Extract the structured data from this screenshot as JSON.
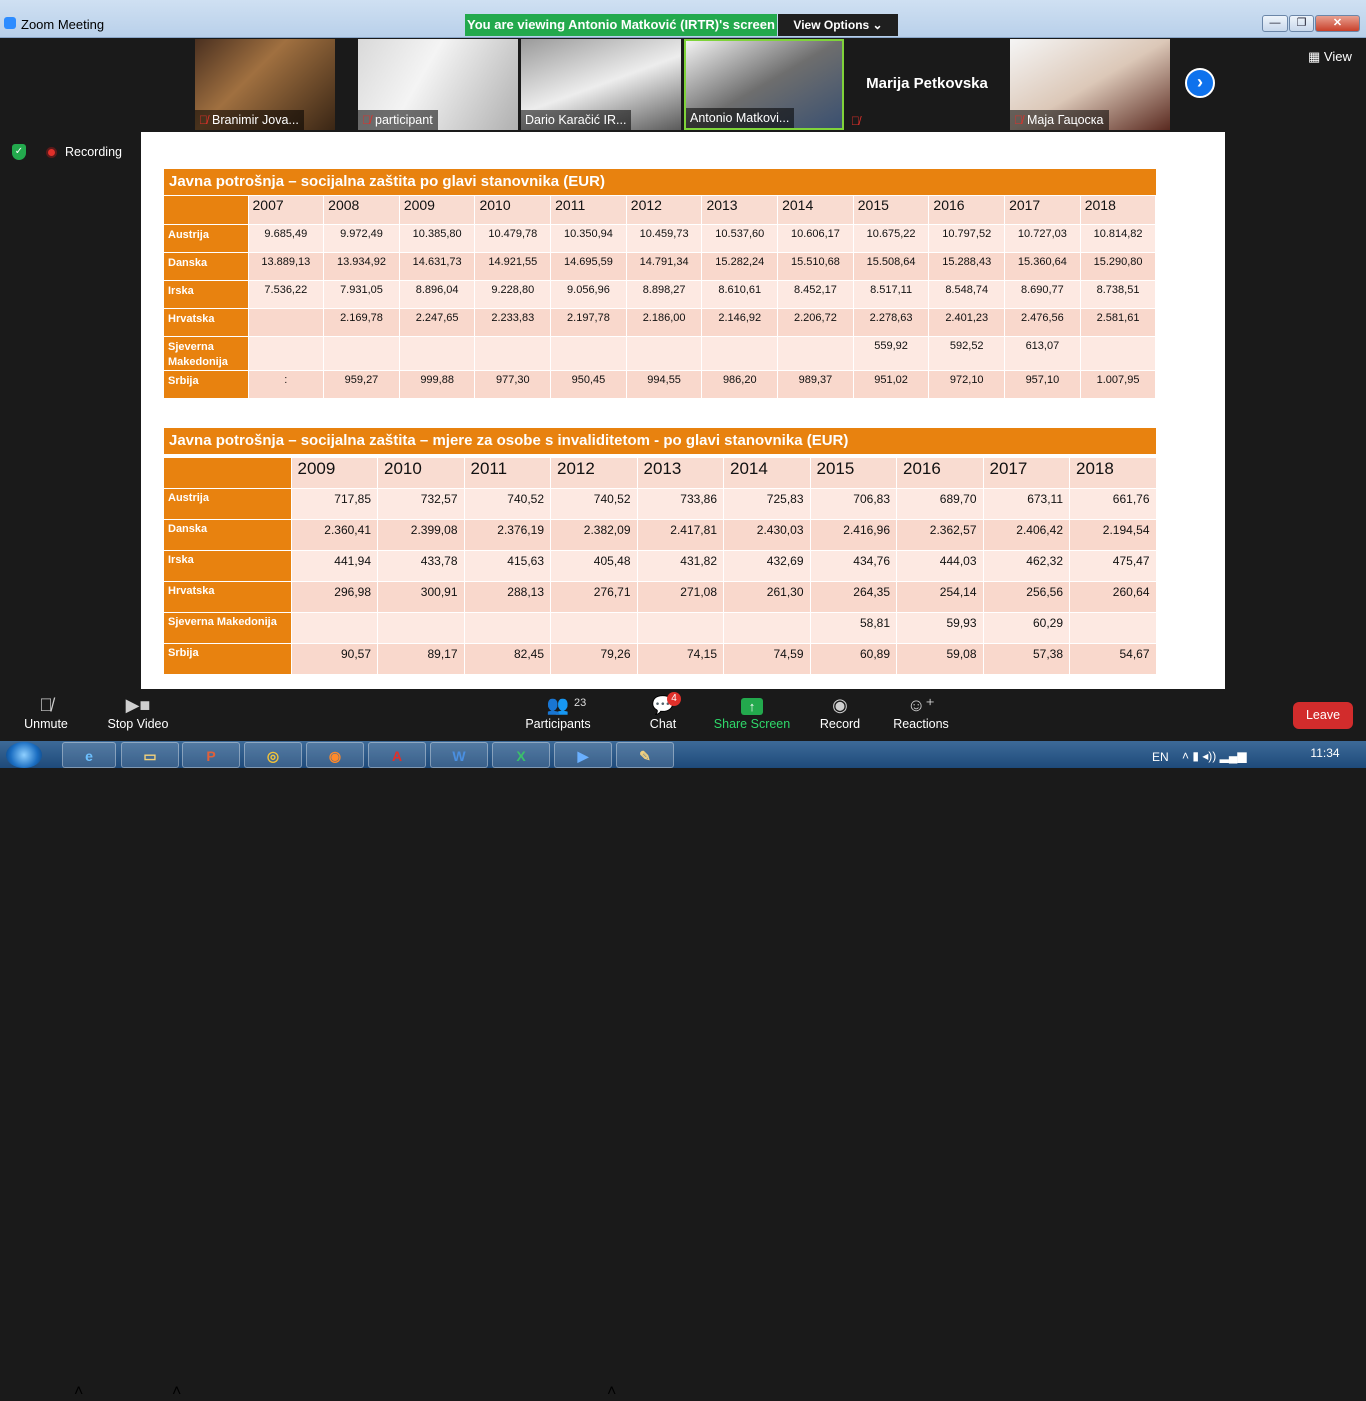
{
  "window": {
    "title": "Zoom Meeting",
    "viewing_banner": "You are viewing Antonio Matković (IRTR)'s screen",
    "view_options": "View Options ⌄",
    "minimize": "—",
    "maximize": "❐",
    "close": "✕"
  },
  "video_strip": {
    "participants": [
      {
        "name": "Branimir Jova...",
        "muted": true
      },
      {
        "name": "participant",
        "muted": true
      },
      {
        "name": "Dario Karačić IR...",
        "muted": false
      },
      {
        "name": "Antonio Matkovi...",
        "muted": false,
        "active_speaker": true
      },
      {
        "name": "Marija Petkovska",
        "muted": true,
        "video_off": true
      },
      {
        "name": "Maja Гацоска",
        "muted": true
      }
    ],
    "next_icon": "chevron-right-icon",
    "view_label": "View"
  },
  "status": {
    "recording_label": "Recording"
  },
  "slide": {
    "table1": {
      "title": "Javna potrošnja – socijalna zaštita po glavi stanovnika (EUR)",
      "years": [
        "2007",
        "2008",
        "2009",
        "2010",
        "2011",
        "2012",
        "2013",
        "2014",
        "2015",
        "2016",
        "2017",
        "2018"
      ],
      "rows": [
        {
          "country": "Austrija",
          "values": [
            "9.685,49",
            "9.972,49",
            "10.385,80",
            "10.479,78",
            "10.350,94",
            "10.459,73",
            "10.537,60",
            "10.606,17",
            "10.675,22",
            "10.797,52",
            "10.727,03",
            "10.814,82"
          ]
        },
        {
          "country": "Danska",
          "values": [
            "13.889,13",
            "13.934,92",
            "14.631,73",
            "14.921,55",
            "14.695,59",
            "14.791,34",
            "15.282,24",
            "15.510,68",
            "15.508,64",
            "15.288,43",
            "15.360,64",
            "15.290,80"
          ]
        },
        {
          "country": "Irska",
          "values": [
            "7.536,22",
            "7.931,05",
            "8.896,04",
            "9.228,80",
            "9.056,96",
            "8.898,27",
            "8.610,61",
            "8.452,17",
            "8.517,11",
            "8.548,74",
            "8.690,77",
            "8.738,51"
          ]
        },
        {
          "country": "Hrvatska",
          "values": [
            "",
            "2.169,78",
            "2.247,65",
            "2.233,83",
            "2.197,78",
            "2.186,00",
            "2.146,92",
            "2.206,72",
            "2.278,63",
            "2.401,23",
            "2.476,56",
            "2.581,61"
          ]
        },
        {
          "country": "Sjeverna Makedonija",
          "values": [
            "",
            "",
            "",
            "",
            "",
            "",
            "",
            "",
            "559,92",
            "592,52",
            "613,07",
            ""
          ]
        },
        {
          "country": "Srbija",
          "values": [
            ":",
            "959,27",
            "999,88",
            "977,30",
            "950,45",
            "994,55",
            "986,20",
            "989,37",
            "951,02",
            "972,10",
            "957,10",
            "1.007,95"
          ]
        }
      ]
    },
    "table2": {
      "title": "Javna potrošnja – socijalna zaštita – mjere za osobe s invaliditetom -  po glavi stanovnika (EUR)",
      "years": [
        "2009",
        "2010",
        "2011",
        "2012",
        "2013",
        "2014",
        "2015",
        "2016",
        "2017",
        "2018"
      ],
      "rows": [
        {
          "country": "Austrija",
          "values": [
            "717,85",
            "732,57",
            "740,52",
            "740,52",
            "733,86",
            "725,83",
            "706,83",
            "689,70",
            "673,11",
            "661,76"
          ]
        },
        {
          "country": "Danska",
          "values": [
            "2.360,41",
            "2.399,08",
            "2.376,19",
            "2.382,09",
            "2.417,81",
            "2.430,03",
            "2.416,96",
            "2.362,57",
            "2.406,42",
            "2.194,54"
          ]
        },
        {
          "country": "Irska",
          "values": [
            "441,94",
            "433,78",
            "415,63",
            "405,48",
            "431,82",
            "432,69",
            "434,76",
            "444,03",
            "462,32",
            "475,47"
          ]
        },
        {
          "country": "Hrvatska",
          "values": [
            "296,98",
            "300,91",
            "288,13",
            "276,71",
            "271,08",
            "261,30",
            "264,35",
            "254,14",
            "256,56",
            "260,64"
          ]
        },
        {
          "country": "Sjeverna Makedonija",
          "values": [
            "",
            "",
            "",
            "",
            "",
            "",
            "58,81",
            "59,93",
            "60,29",
            ""
          ]
        },
        {
          "country": "Srbija",
          "values": [
            "90,57",
            "89,17",
            "82,45",
            "79,26",
            "74,15",
            "74,59",
            "60,89",
            "59,08",
            "57,38",
            "54,67"
          ]
        }
      ]
    }
  },
  "toolbar": {
    "unmute": "Unmute",
    "stop_video": "Stop Video",
    "participants": "Participants",
    "participant_count": "23",
    "chat": "Chat",
    "chat_badge": "4",
    "share_screen": "Share Screen",
    "record": "Record",
    "reactions": "Reactions",
    "leave": "Leave"
  },
  "taskbar": {
    "apps": [
      "internet-explorer",
      "file-explorer",
      "powerpoint",
      "chrome",
      "firefox",
      "acrobat",
      "word",
      "excel",
      "zoom",
      "paint"
    ],
    "language": "EN",
    "time": "11:34"
  },
  "colors": {
    "table_header": "#e8820f",
    "row_light": "#fde9e2",
    "row_dark": "#f9d8cc",
    "banner_green": "#23a94d",
    "leave_red": "#d22c2c"
  }
}
